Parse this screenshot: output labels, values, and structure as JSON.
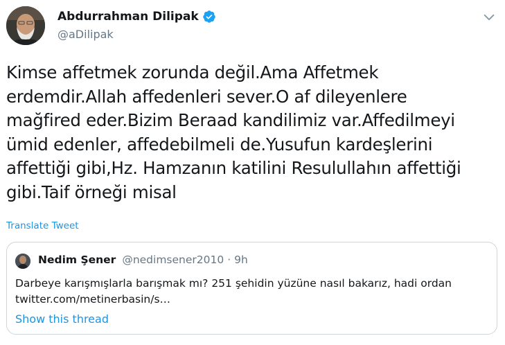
{
  "author": {
    "display_name": "Abdurrahman Dilipak",
    "handle": "@aDilipak",
    "verified": true
  },
  "tweet": {
    "text": "Kimse affetmek zorunda değil.Ama Affetmek\nerdemdir.Allah affedenleri sever.O af dileyenlere\nmağfired eder.Bizim Beraad kandilimiz var.Affedilmeyi\nümid edenler, affedebilmeli de.Yusufun kardeşlerini\naffettiği gibi,Hz. Hamzanın katilini Resulullahın affettiği\ngibi.Taif örneği misal",
    "translate_label": "Translate Tweet"
  },
  "quoted_tweet": {
    "display_name": "Nedim Şener",
    "handle": "@nedimsener2010",
    "separator": "·",
    "time": "9h",
    "text": "Darbeye karışmışlarla barışmak mı? 251 şehidin yüzüne nasıl bakarız, hadi ordan\ntwitter.com/metinerbasin/s…",
    "show_thread_label": "Show this thread"
  },
  "colors": {
    "link": "#1b95e0",
    "secondary_text": "#657786",
    "primary_text": "#14171a",
    "border": "#ccd6dd",
    "verified": "#1da1f2"
  },
  "icons": {
    "verified": "verified-badge-icon",
    "menu": "chevron-down-icon"
  }
}
